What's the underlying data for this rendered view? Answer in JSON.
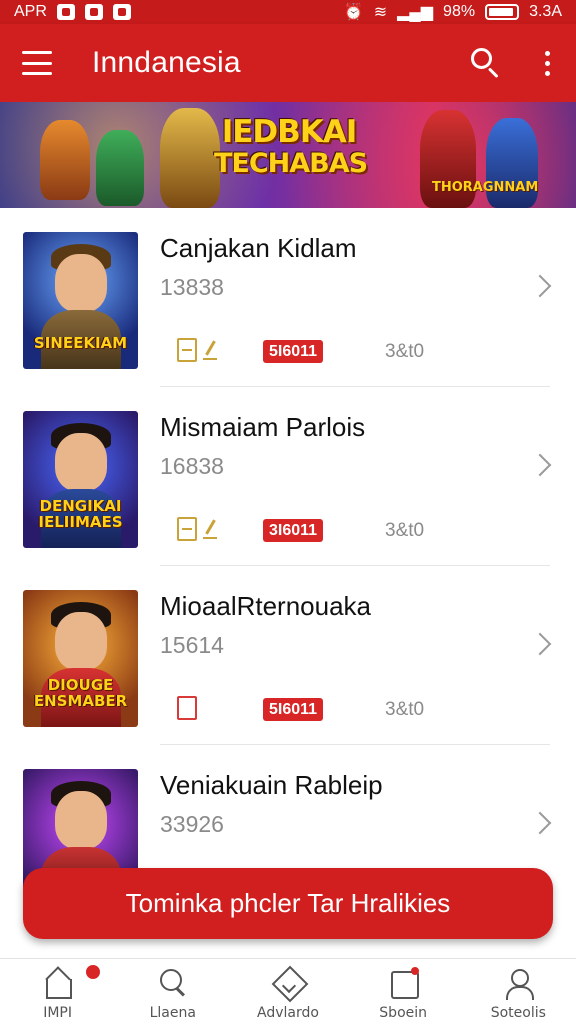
{
  "status_bar": {
    "left_text": "APR",
    "right_battery": "98%",
    "time": "3.3A"
  },
  "app_bar": {
    "title": "Inndanesia"
  },
  "banner": {
    "title_line1": "IEDBKAI",
    "title_line2": "TECHABAS",
    "tagline": "THORAGNNAM"
  },
  "items": [
    {
      "title": "Canjakan Kidlam",
      "count": "13838",
      "badge": "5I6011",
      "meta": "3&t0",
      "thumb_caption": "SINEEKIAM",
      "icons": [
        "doc-gold",
        "edit-gold"
      ]
    },
    {
      "title": "Mismaiam Parlois",
      "count": "16838",
      "badge": "3I6011",
      "meta": "3&t0",
      "thumb_caption": "DENGIKAI IELIIMAES",
      "icons": [
        "doc-gold",
        "edit-gold"
      ]
    },
    {
      "title": "MioaalRternouaka",
      "count": "15614",
      "badge": "5I6011",
      "meta": "3&t0",
      "thumb_caption": "DIOUGE ENSMABER",
      "icons": [
        "doc-red"
      ]
    },
    {
      "title": "Veniakuain Rableip",
      "count": "33926",
      "badge": "",
      "meta": "",
      "thumb_caption": "",
      "icons": []
    }
  ],
  "cta": {
    "label": "Tominka phcler Tar Hralikies"
  },
  "bottom_nav": [
    {
      "label": "IMPI",
      "icon": "home-icon"
    },
    {
      "label": "Llaena",
      "icon": "search-icon"
    },
    {
      "label": "Advlardo",
      "icon": "explore-icon"
    },
    {
      "label": "Sboein",
      "icon": "store-icon"
    },
    {
      "label": "Soteolis",
      "icon": "profile-icon"
    }
  ],
  "colors": {
    "primary": "#d11f1f",
    "badge": "#d82626",
    "accent_gold": "#c9a23a"
  }
}
